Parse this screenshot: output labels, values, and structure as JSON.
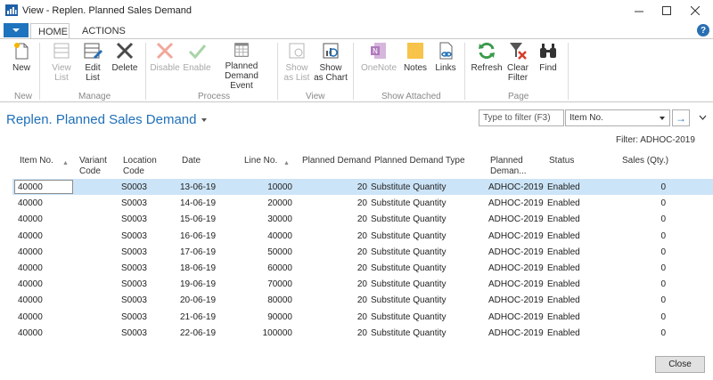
{
  "window": {
    "title": "View - Replen. Planned Sales Demand"
  },
  "ribbon": {
    "tabs": [
      "HOME",
      "ACTIONS"
    ],
    "groups": [
      {
        "label": "New",
        "buttons": [
          {
            "label": "New",
            "icon": "new-icon",
            "enabled": true
          }
        ]
      },
      {
        "label": "Manage",
        "buttons": [
          {
            "label": "View List",
            "icon": "view-list-icon",
            "enabled": false
          },
          {
            "label": "Edit List",
            "icon": "edit-list-icon",
            "enabled": true
          },
          {
            "label": "Delete",
            "icon": "delete-icon",
            "enabled": true
          }
        ]
      },
      {
        "label": "Process",
        "buttons": [
          {
            "label": "Disable",
            "icon": "disable-icon",
            "enabled": false
          },
          {
            "label": "Enable",
            "icon": "enable-icon",
            "enabled": false
          },
          {
            "label": "Planned Demand Event",
            "icon": "calendar-icon",
            "enabled": true
          }
        ]
      },
      {
        "label": "View",
        "buttons": [
          {
            "label": "Show as List",
            "icon": "show-as-list-icon",
            "enabled": false
          },
          {
            "label": "Show as Chart",
            "icon": "show-as-chart-icon",
            "enabled": true
          }
        ]
      },
      {
        "label": "Show Attached",
        "buttons": [
          {
            "label": "OneNote",
            "icon": "onenote-icon",
            "enabled": false
          },
          {
            "label": "Notes",
            "icon": "notes-icon",
            "enabled": true
          },
          {
            "label": "Links",
            "icon": "links-icon",
            "enabled": true
          }
        ]
      },
      {
        "label": "Page",
        "buttons": [
          {
            "label": "Refresh",
            "icon": "refresh-icon",
            "enabled": true
          },
          {
            "label": "Clear Filter",
            "icon": "clear-filter-icon",
            "enabled": true
          },
          {
            "label": "Find",
            "icon": "find-icon",
            "enabled": true
          }
        ]
      }
    ]
  },
  "page": {
    "title": "Replen. Planned Sales Demand",
    "filter_placeholder": "Type to filter (F3)",
    "filter_field": "Item No.",
    "filter_caption": "Filter: ADHOC-2019"
  },
  "table": {
    "columns": [
      "Item No.",
      "Variant Code",
      "Location Code",
      "Date",
      "Line No.",
      "Planned Demand",
      "Planned Demand Type",
      "Planned Deman...",
      "Status",
      "Sales (Qty.)"
    ],
    "rows": [
      [
        "40000",
        "",
        "S0003",
        "13-06-19",
        "10000",
        "20",
        "Substitute Quantity",
        "ADHOC-2019",
        "Enabled",
        "0"
      ],
      [
        "40000",
        "",
        "S0003",
        "14-06-19",
        "20000",
        "20",
        "Substitute Quantity",
        "ADHOC-2019",
        "Enabled",
        "0"
      ],
      [
        "40000",
        "",
        "S0003",
        "15-06-19",
        "30000",
        "20",
        "Substitute Quantity",
        "ADHOC-2019",
        "Enabled",
        "0"
      ],
      [
        "40000",
        "",
        "S0003",
        "16-06-19",
        "40000",
        "20",
        "Substitute Quantity",
        "ADHOC-2019",
        "Enabled",
        "0"
      ],
      [
        "40000",
        "",
        "S0003",
        "17-06-19",
        "50000",
        "20",
        "Substitute Quantity",
        "ADHOC-2019",
        "Enabled",
        "0"
      ],
      [
        "40000",
        "",
        "S0003",
        "18-06-19",
        "60000",
        "20",
        "Substitute Quantity",
        "ADHOC-2019",
        "Enabled",
        "0"
      ],
      [
        "40000",
        "",
        "S0003",
        "19-06-19",
        "70000",
        "20",
        "Substitute Quantity",
        "ADHOC-2019",
        "Enabled",
        "0"
      ],
      [
        "40000",
        "",
        "S0003",
        "20-06-19",
        "80000",
        "20",
        "Substitute Quantity",
        "ADHOC-2019",
        "Enabled",
        "0"
      ],
      [
        "40000",
        "",
        "S0003",
        "21-06-19",
        "90000",
        "20",
        "Substitute Quantity",
        "ADHOC-2019",
        "Enabled",
        "0"
      ],
      [
        "40000",
        "",
        "S0003",
        "22-06-19",
        "100000",
        "20",
        "Substitute Quantity",
        "ADHOC-2019",
        "Enabled",
        "0"
      ]
    ]
  },
  "footer": {
    "close_label": "Close"
  }
}
